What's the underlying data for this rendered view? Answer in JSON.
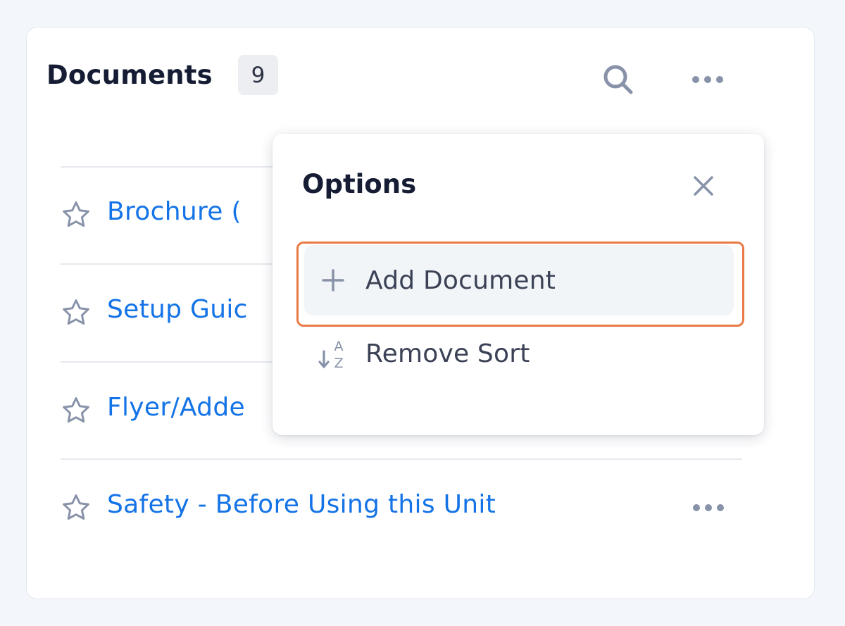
{
  "panel": {
    "title": "Documents",
    "count": "9"
  },
  "documents": [
    {
      "label": "Brochure (",
      "starred": false
    },
    {
      "label": "Setup Guic",
      "starred": false
    },
    {
      "label": "Flyer/Adde",
      "starred": false
    },
    {
      "label": "Safety - Before Using this Unit",
      "starred": false
    }
  ],
  "options_menu": {
    "title": "Options",
    "items": [
      {
        "label": "Add Document",
        "icon": "plus-icon"
      },
      {
        "label": "Remove Sort",
        "icon": "sort-az-icon"
      }
    ]
  },
  "colors": {
    "link": "#1473e6",
    "highlight": "#ea7a45",
    "icon": "#8892a8"
  }
}
